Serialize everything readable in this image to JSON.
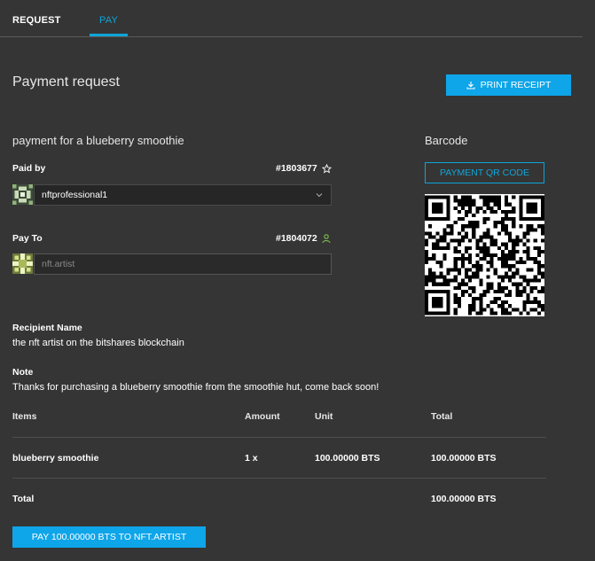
{
  "tabs": [
    {
      "label": "REQUEST",
      "active": false
    },
    {
      "label": "PAY",
      "active": true
    }
  ],
  "page_title": "Payment request",
  "print_button": {
    "label": "PRINT RECEIPT",
    "icon": "download-icon"
  },
  "memo_title": "payment for a blueberry smoothie",
  "barcode": {
    "title": "Barcode",
    "qr_button_label": "PAYMENT QR CODE"
  },
  "paid_by": {
    "label": "Paid by",
    "account_id": "#1803677",
    "account_name": "nftprofessional1",
    "icon": "star-outline-icon"
  },
  "pay_to": {
    "label": "Pay To",
    "account_id": "#1804072",
    "account_name": "nft.artist",
    "icon": "user-icon"
  },
  "recipient": {
    "label": "Recipient Name",
    "value": "the nft artist on the bitshares blockchain"
  },
  "note": {
    "label": "Note",
    "value": "Thanks for purchasing a blueberry smoothie from the smoothie hut, come back soon!"
  },
  "table": {
    "headers": [
      "Items",
      "Amount",
      "Unit",
      "Total"
    ],
    "rows": [
      {
        "item": "blueberry smoothie",
        "amount": "1 x",
        "unit": "100.00000 BTS",
        "total": "100.00000 BTS"
      }
    ],
    "total_label": "Total",
    "total_value": "100.00000 BTS"
  },
  "pay_button": {
    "label": "PAY 100.00000 BTS TO NFT.ARTIST"
  },
  "colors": {
    "background": "#353535",
    "accent": "#0ea5e9",
    "success": "#7ec34a"
  }
}
